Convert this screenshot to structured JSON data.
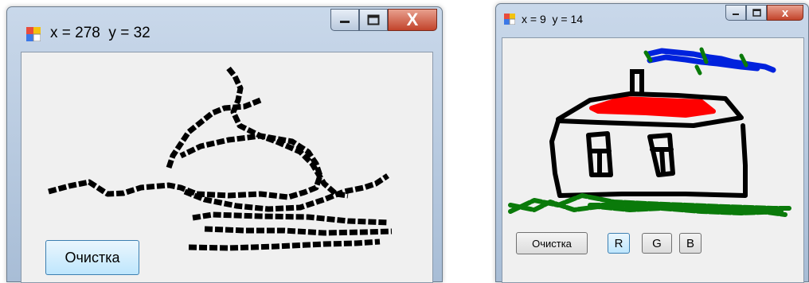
{
  "window1": {
    "title": "x = 278  y = 32",
    "clear_button": "Очистка",
    "close_glyph": "X"
  },
  "window2": {
    "title": "x = 9  y = 14",
    "clear_button": "Очистка",
    "color_buttons": [
      "R",
      "G",
      "B"
    ],
    "close_glyph": "x"
  },
  "icons": {
    "app_icon": "windows-forms-app-icon",
    "minimize": "minimize-icon",
    "maximize": "maximize-icon",
    "close": "close-icon"
  },
  "colors": {
    "ink_black": "#000000",
    "ink_red": "#ff0000",
    "ink_green": "#0a7a0a",
    "ink_blue": "#0022dd"
  }
}
